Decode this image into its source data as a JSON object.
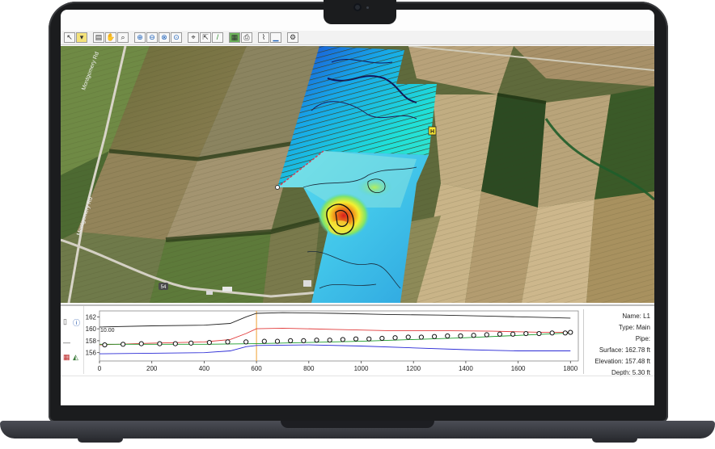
{
  "toolbar": {
    "icons": [
      "select-icon",
      "layer-icon",
      "copy-icon",
      "hand-icon",
      "zoom-in-icon",
      "zoom-out-icon",
      "zoom-extent-icon",
      "zoom-window-icon",
      "find-icon",
      "measure-icon",
      "pencil-icon",
      "surface-icon",
      "print-icon",
      "profile-icon",
      "chart-icon",
      "settings-icon"
    ]
  },
  "map": {
    "road_label_upper": "Montgomery Rd",
    "road_label_lower": "Montgomery Rd",
    "route_shield": "54",
    "start_marker": "S",
    "end_marker": "H"
  },
  "profile": {
    "marker_value": "10.00",
    "info": {
      "name": "Name: L1",
      "type": "Type: Main",
      "pipe": "Pipe:",
      "surface": "Surface: 162.78 ft",
      "elevation": "Elevation: 157.48 ft",
      "depth": "Depth: 5.30 ft"
    }
  },
  "chart_data": {
    "type": "line",
    "xlabel": "",
    "ylabel": "",
    "xlim": [
      0,
      1830
    ],
    "ylim": [
      154.6,
      163
    ],
    "x_ticks": [
      0,
      200,
      400,
      600,
      800,
      1000,
      1200,
      1400,
      1600,
      1800
    ],
    "y_ticks": [
      156,
      158,
      160,
      162
    ],
    "cursor_x": 600,
    "series": [
      {
        "color": "#222222",
        "x": [
          0,
          200,
          400,
          500,
          560,
          600,
          700,
          900,
          1100,
          1300,
          1500,
          1700,
          1800
        ],
        "values": [
          160.3,
          160.5,
          160.6,
          160.9,
          162.0,
          162.6,
          162.7,
          162.6,
          162.4,
          162.3,
          162.1,
          161.9,
          161.8
        ]
      },
      {
        "color": "#e23b3b",
        "x": [
          0,
          200,
          400,
          500,
          560,
          600,
          700,
          900,
          1100,
          1300,
          1500,
          1700,
          1800
        ],
        "values": [
          157.3,
          157.6,
          157.8,
          158.2,
          159.2,
          160.0,
          160.1,
          159.9,
          159.7,
          159.7,
          159.6,
          159.4,
          159.4
        ]
      },
      {
        "color": "#1a9b2a",
        "x": [
          0,
          200,
          400,
          600,
          800,
          1000,
          1200,
          1400,
          1600,
          1800
        ],
        "values": [
          157.4,
          157.4,
          157.4,
          157.5,
          157.7,
          157.9,
          158.2,
          158.5,
          158.9,
          159.3
        ]
      },
      {
        "color": "#2b2bd6",
        "x": [
          0,
          200,
          400,
          500,
          560,
          600,
          800,
          1000,
          1200,
          1400,
          1600,
          1800
        ],
        "values": [
          155.8,
          155.9,
          156.0,
          156.3,
          157.0,
          157.2,
          157.3,
          157.1,
          156.8,
          156.5,
          156.3,
          156.3
        ]
      }
    ],
    "points": {
      "x": [
        20,
        90,
        160,
        230,
        290,
        350,
        420,
        490,
        560,
        630,
        680,
        730,
        780,
        830,
        880,
        930,
        980,
        1030,
        1080,
        1130,
        1180,
        1230,
        1280,
        1330,
        1380,
        1430,
        1480,
        1530,
        1580,
        1630,
        1680,
        1730,
        1780,
        1800
      ],
      "values": [
        157.3,
        157.4,
        157.5,
        157.5,
        157.5,
        157.6,
        157.7,
        157.8,
        157.8,
        157.9,
        157.9,
        158.0,
        158.0,
        158.1,
        158.1,
        158.2,
        158.3,
        158.3,
        158.4,
        158.5,
        158.6,
        158.6,
        158.7,
        158.8,
        158.8,
        158.9,
        159.0,
        159.1,
        159.1,
        159.2,
        159.2,
        159.3,
        159.3,
        159.4
      ]
    }
  }
}
